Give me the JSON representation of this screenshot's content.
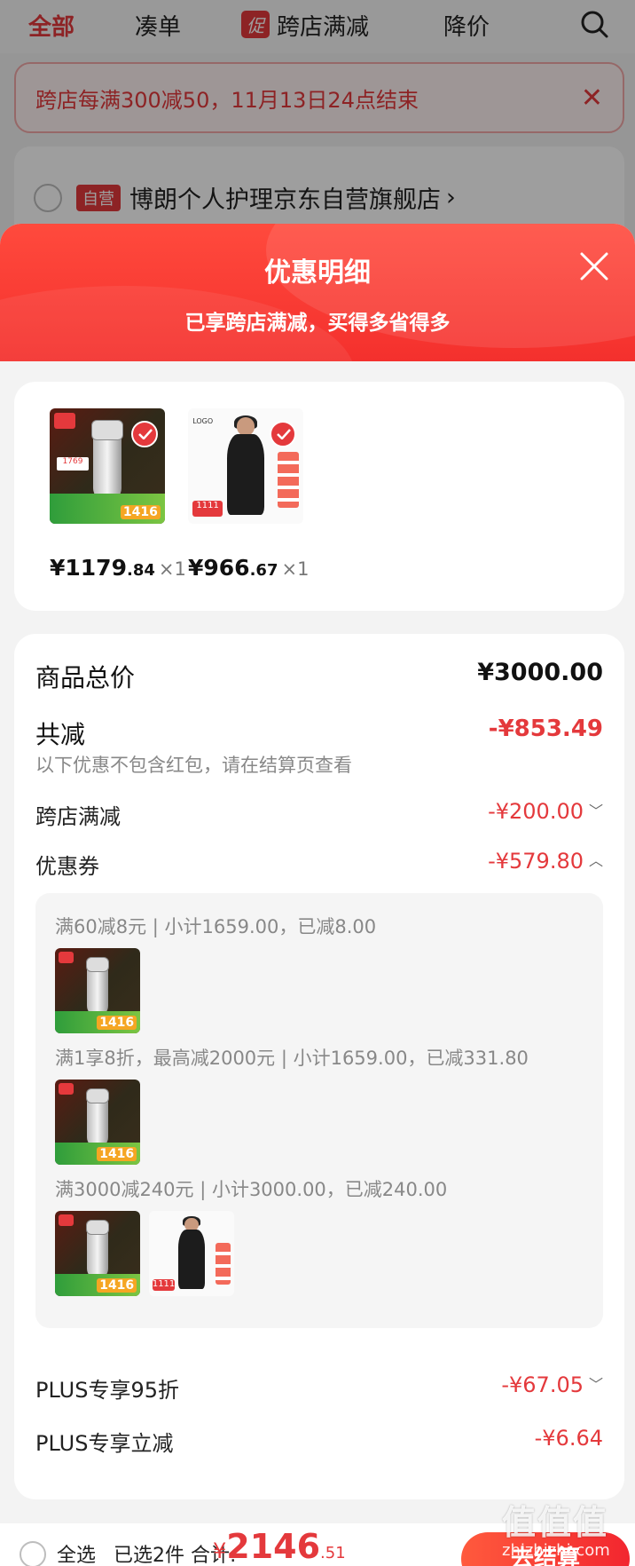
{
  "top_nav": {
    "tabs": [
      "全部",
      "凑单",
      "跨店满减",
      "降价"
    ],
    "active": "全部",
    "promo_tag": "促",
    "search_icon": "search-icon"
  },
  "notice": {
    "text": "跨店每满300减50，11月13日24点结束",
    "close_icon": "close-icon"
  },
  "store": {
    "self_tag": "自营",
    "name": "博朗个人护理京东自营旗舰店",
    "chevron": "›"
  },
  "sheet": {
    "title": "优惠明细",
    "subtitle": "已享跨店满减，买得多省得多",
    "close_icon": "close-icon"
  },
  "products": [
    {
      "price_int": "¥1179",
      "price_dec": ".84",
      "qty": "×1",
      "thumb": "shaver",
      "thumb_tag": "1416"
    },
    {
      "price_int": "¥966",
      "price_dec": ".67",
      "qty": "×1",
      "thumb": "dress",
      "thumb_tag": "1111"
    }
  ],
  "summary": {
    "total_label": "商品总价",
    "total_value": "¥3000.00",
    "discount_label": "共减",
    "discount_value": "-¥853.49",
    "hint": "以下优惠不包含红包，请在结算页查看",
    "items": [
      {
        "label": "跨店满减",
        "value": "-¥200.00",
        "chevron": "chevron-down"
      },
      {
        "label": "优惠券",
        "value": "-¥579.80",
        "chevron": "chevron-up"
      }
    ],
    "coupon_lines": [
      "满60减8元 | 小计1659.00，已减8.00",
      "满1享8折，最高减2000元 | 小计1659.00，已减331.80",
      "满3000减240元 | 小计3000.00，已减240.00"
    ],
    "plus_items": [
      {
        "label": "PLUS专享95折",
        "value": "-¥67.05",
        "chevron": "chevron-down"
      },
      {
        "label": "PLUS专享立减",
        "value": "-¥6.64"
      }
    ]
  },
  "bottom_bar": {
    "select_all": "全选",
    "selected": "已选2件 合计:",
    "yen": "¥",
    "total_int": "2146",
    "total_dec": ".51",
    "checkout": "去结算"
  },
  "watermark": {
    "main": "值值值",
    "sub": "zhizhizhi.com"
  },
  "colors": {
    "accent": "#e4393c",
    "header_gradient_start": "#ff4a3d",
    "header_gradient_end": "#f4302d",
    "sheet_bg": "#f3f3f3"
  }
}
